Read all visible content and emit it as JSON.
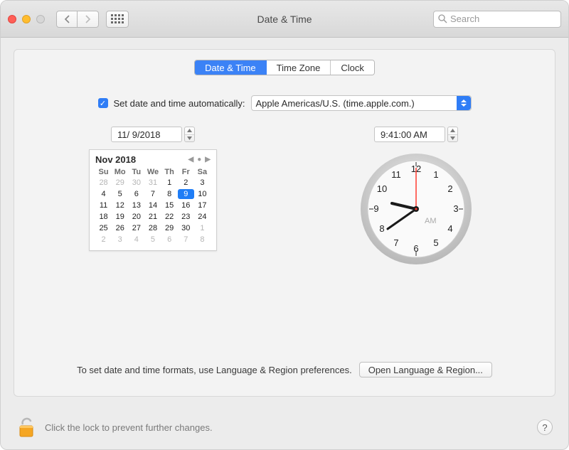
{
  "window": {
    "title": "Date & Time"
  },
  "search": {
    "placeholder": "Search"
  },
  "tabs": {
    "date_time": "Date & Time",
    "time_zone": "Time Zone",
    "clock": "Clock"
  },
  "auto": {
    "label": "Set date and time automatically:",
    "server": "Apple Americas/U.S. (time.apple.com.)"
  },
  "date_field": "11/  9/2018",
  "time_field": "9:41:00 AM",
  "calendar": {
    "title": "Nov 2018",
    "dow": [
      "Su",
      "Mo",
      "Tu",
      "We",
      "Th",
      "Fr",
      "Sa"
    ],
    "lead_dim": [
      "28",
      "29",
      "30",
      "31"
    ],
    "days": [
      "1",
      "2",
      "3",
      "4",
      "5",
      "6",
      "7",
      "8",
      "9",
      "10",
      "11",
      "12",
      "13",
      "14",
      "15",
      "16",
      "17",
      "18",
      "19",
      "20",
      "21",
      "22",
      "23",
      "24",
      "25",
      "26",
      "27",
      "28",
      "29",
      "30"
    ],
    "trail_dim": [
      "1",
      "2",
      "3",
      "4",
      "5",
      "6",
      "7",
      "8"
    ],
    "selected": "9"
  },
  "clock": {
    "ampm": "AM"
  },
  "formats": {
    "note": "To set date and time formats, use Language & Region preferences.",
    "button": "Open Language & Region..."
  },
  "lock": {
    "text": "Click the lock to prevent further changes."
  },
  "help": {
    "label": "?"
  }
}
